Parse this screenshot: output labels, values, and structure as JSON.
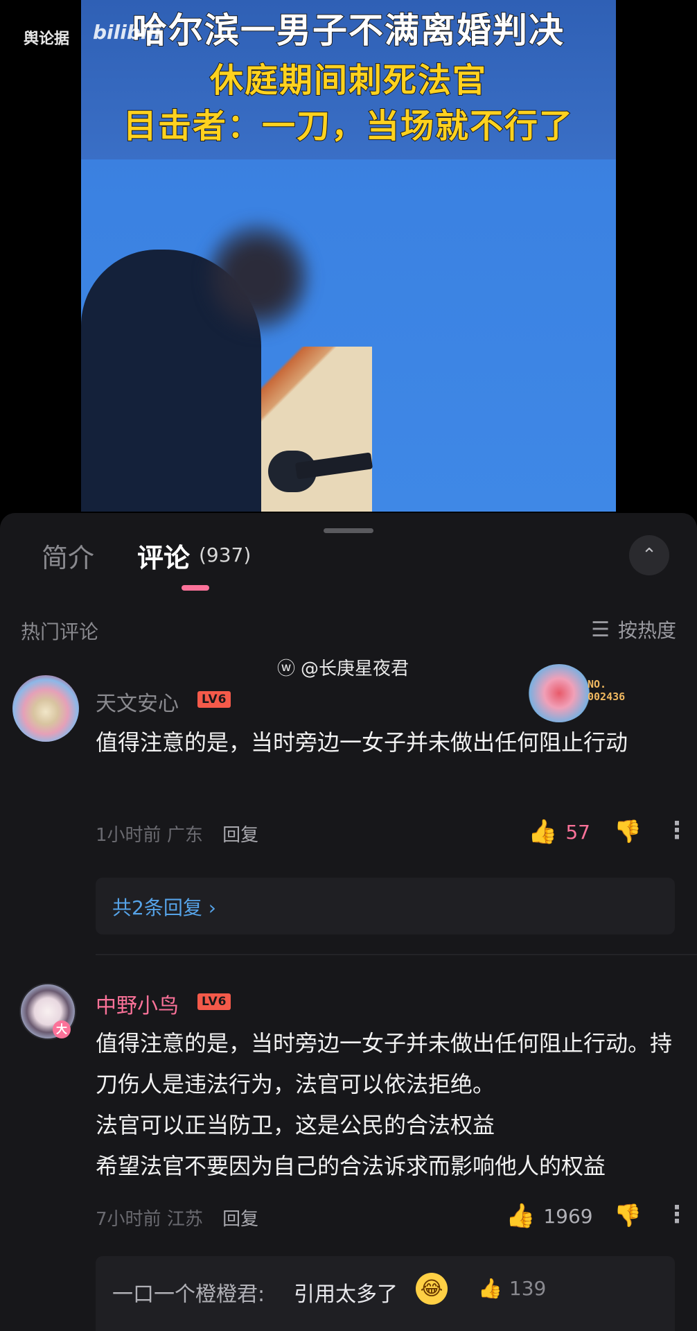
{
  "video": {
    "source_watermark": "舆论据",
    "bili_logo": "bilibili",
    "headline_1": "哈尔滨一男子不满离婚判决",
    "headline_2": "休庭期间刺死法官",
    "headline_3": "目击者：一刀，当场就不行了"
  },
  "tabs": {
    "intro_label": "简介",
    "comments_label": "评论",
    "comments_count": "(937)"
  },
  "section": {
    "hot_title": "热门评论",
    "sort_label": "按热度",
    "sort_icon": "list-icon",
    "expand_icon": "up-down-chevron-icon"
  },
  "watermark": {
    "weibo_handle": "@长庚星夜君",
    "icon": "weibo-icon"
  },
  "comments": [
    {
      "username": "天文安心",
      "level": "LV6",
      "fan_badge_number": "NO.\n002436",
      "text": "值得注意的是，当时旁边一女子并未做出任何阻止行动",
      "time": "1小时前",
      "location": "广东",
      "reply_label": "回复",
      "likes": "57",
      "liked": true,
      "replies_link": "共2条回复 ›"
    },
    {
      "username": "中野小鸟",
      "level": "LV6",
      "avatar_badge": "大",
      "text": "值得注意的是，当时旁边一女子并未做出任何阻止行动。持刀伤人是违法行为，法官可以依法拒绝。\n法官可以正当防卫，这是公民的合法权益\n希望法官不要因为自己的合法诉求而影响他人的权益",
      "time": "7小时前",
      "location": "江苏",
      "reply_label": "回复",
      "likes": "1969",
      "liked": false,
      "sub_reply": {
        "user": "一口一个橙橙君:",
        "text": "引用太多了",
        "emoji": "crying-laugh-emoji",
        "likes": "139"
      }
    }
  ],
  "colors": {
    "accent_pink": "#fb7299",
    "link_blue": "#56a3e8",
    "panel_bg": "#17171a",
    "level_red": "#f45a4a"
  }
}
